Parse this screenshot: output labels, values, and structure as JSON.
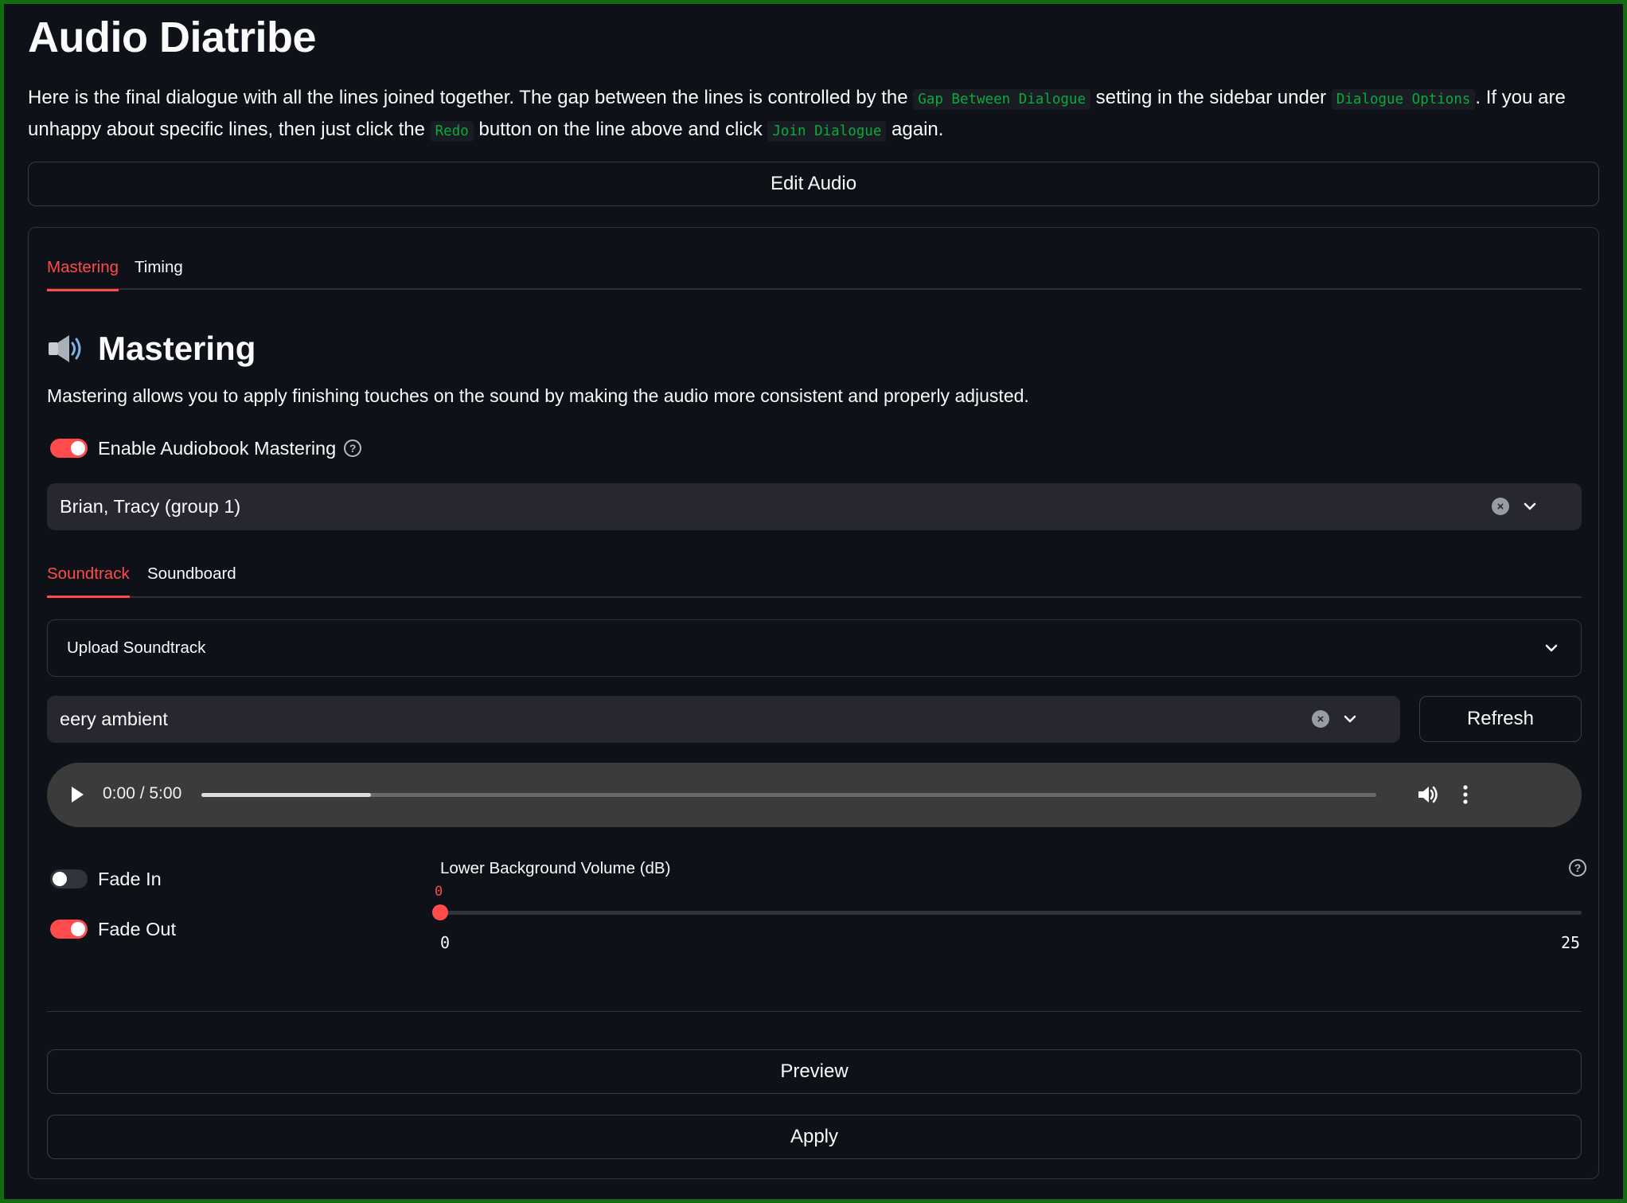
{
  "app": {
    "title": "Audio Diatribe"
  },
  "intro": {
    "text1": "Here is the final dialogue with all the lines joined together. The gap between the lines is controlled by the ",
    "code1": "Gap Between Dialogue",
    "text2": " setting in the sidebar under ",
    "code2": "Dialogue Options",
    "text3": ". If you are unhappy about specific lines, then just click the ",
    "code3": "Redo",
    "text4": " button on the line above and click ",
    "code4": "Join Dialogue",
    "text5": " again."
  },
  "edit_audio_label": "Edit Audio",
  "tabs": [
    {
      "label": "Mastering",
      "active": true
    },
    {
      "label": "Timing",
      "active": false
    }
  ],
  "mastering": {
    "heading": "Mastering",
    "description": "Mastering allows you to apply finishing touches on the sound by making the audio more consistent and properly adjusted.",
    "enable_label": "Enable Audiobook Mastering",
    "enable_on": true,
    "group_select": "Brian, Tracy (group 1)"
  },
  "subtabs": [
    {
      "label": "Soundtrack",
      "active": true
    },
    {
      "label": "Soundboard",
      "active": false
    }
  ],
  "soundtrack": {
    "upload_label": "Upload Soundtrack",
    "selected": "eery ambient",
    "refresh_label": "Refresh"
  },
  "player": {
    "time": "0:00 / 5:00",
    "progress_fraction": 0.144
  },
  "fade": {
    "fade_in_label": "Fade In",
    "fade_in_on": false,
    "fade_out_label": "Fade Out",
    "fade_out_on": true
  },
  "slider": {
    "label": "Lower Background Volume (dB)",
    "value": "0",
    "min": "0",
    "max": "25"
  },
  "preview_label": "Preview",
  "apply_label": "Apply",
  "colors": {
    "background": "#0e1117",
    "accent": "#ff4b4b",
    "code": "#09ab3b",
    "frame": "#146c12"
  },
  "icons": [
    "speaker-icon",
    "help-icon",
    "clear-icon",
    "chevron-down-icon",
    "play-icon",
    "volume-icon",
    "more-vertical-icon"
  ]
}
